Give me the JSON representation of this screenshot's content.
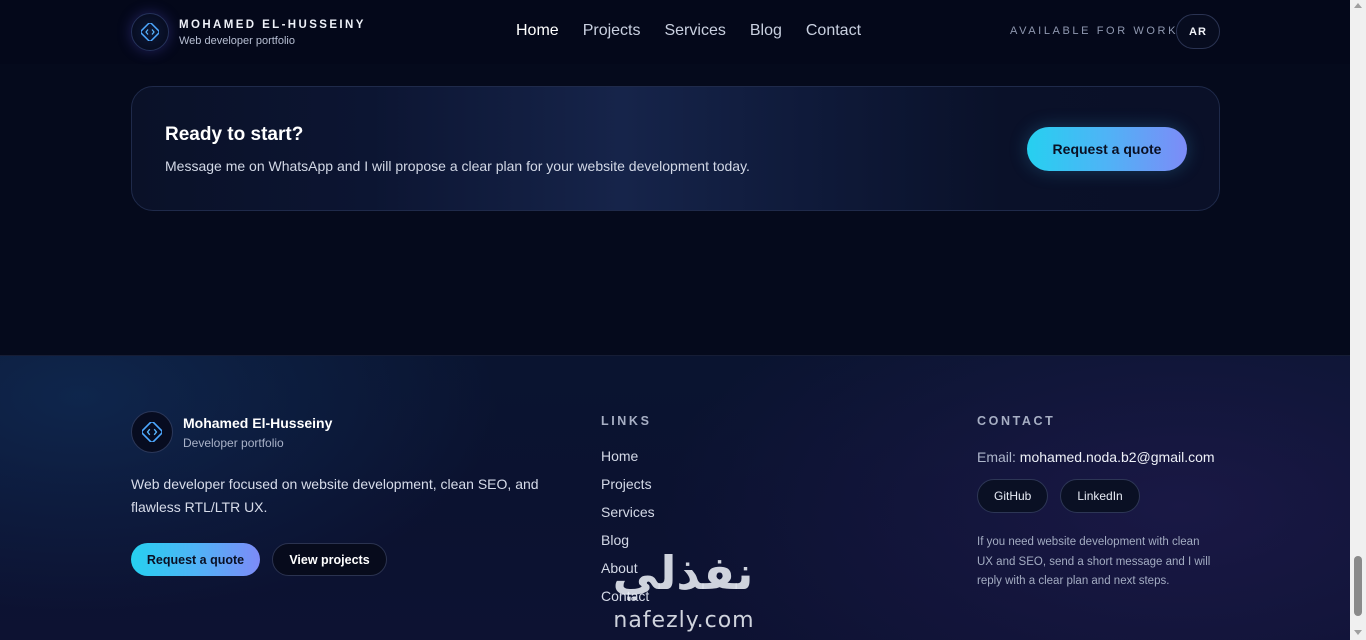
{
  "header": {
    "brand_title": "MOHAMED EL-HUSSEINY",
    "brand_subtitle": "Web developer portfolio",
    "logo_icon": "code-icon",
    "nav": [
      {
        "label": "Home",
        "active": true
      },
      {
        "label": "Projects",
        "active": false
      },
      {
        "label": "Services",
        "active": false
      },
      {
        "label": "Blog",
        "active": false
      },
      {
        "label": "Contact",
        "active": false
      }
    ],
    "availability": "AVAILABLE FOR WORK",
    "language_button": "AR"
  },
  "cta": {
    "title": "Ready to start?",
    "text": "Message me on WhatsApp and I will propose a clear plan for your website development today.",
    "button_label": "Request a quote"
  },
  "footer": {
    "brand_title": "Mohamed El-Husseiny",
    "brand_subtitle": "Developer portfolio",
    "description": "Web developer focused on website development, clean SEO, and flawless RTL/LTR UX.",
    "quote_button": "Request a quote",
    "projects_button": "View projects",
    "links_heading": "LINKS",
    "links": [
      "Home",
      "Projects",
      "Services",
      "Blog",
      "About",
      "Contact"
    ],
    "contact_heading": "CONTACT",
    "email_label": "Email:",
    "email_value": "mohamed.noda.b2@gmail.com",
    "socials": [
      "GitHub",
      "LinkedIn"
    ],
    "note": "If you need website development with clean UX and SEO, send a short message and I will reply with a clear plan and next steps."
  },
  "watermark": {
    "arabic": "نفذلي",
    "latin": "nafezly.com"
  },
  "colors": {
    "background": "#050a1c",
    "accent_start": "#26d0f0",
    "accent_end": "#7d8bf7",
    "card_border": "#1f2a4a"
  }
}
